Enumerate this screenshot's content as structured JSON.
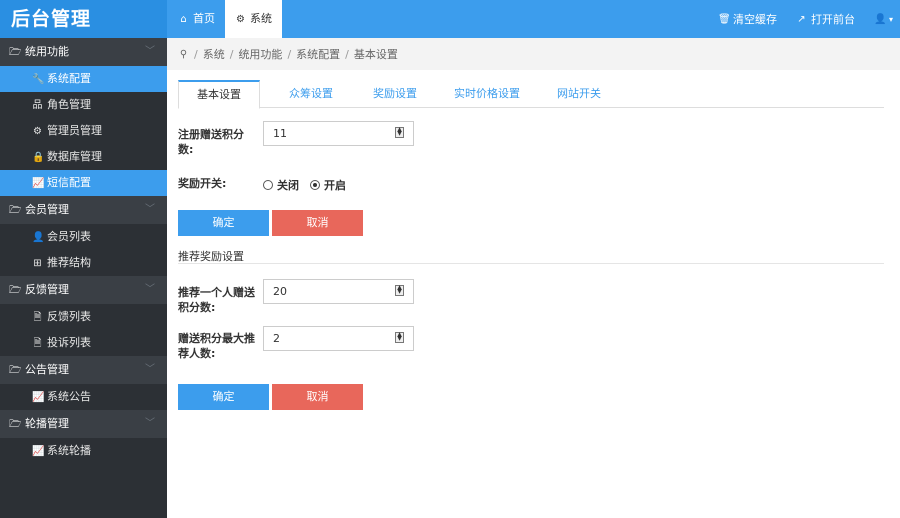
{
  "app": {
    "title": "后台管理"
  },
  "top_tabs": [
    {
      "icon": "home-icon",
      "label": "首页"
    },
    {
      "icon": "gear-icon",
      "label": "系统"
    }
  ],
  "top_actions": {
    "clear_cache": "清空缓存",
    "open_front": "打开前台"
  },
  "sidebar": {
    "groups": [
      {
        "label": "统用功能",
        "items": [
          {
            "icon": "wrench-icon",
            "label": "系统配置"
          },
          {
            "icon": "sitemap-icon",
            "label": "角色管理"
          },
          {
            "icon": "gear-icon",
            "label": "管理员管理"
          },
          {
            "icon": "lock-icon",
            "label": "数据库管理"
          },
          {
            "icon": "chart-icon",
            "label": "短信配置"
          }
        ]
      },
      {
        "label": "会员管理",
        "items": [
          {
            "icon": "user-icon",
            "label": "会员列表"
          },
          {
            "icon": "grid-icon",
            "label": "推荐结构"
          }
        ]
      },
      {
        "label": "反馈管理",
        "items": [
          {
            "icon": "doc-icon",
            "label": "反馈列表"
          },
          {
            "icon": "doc-icon",
            "label": "投诉列表"
          }
        ]
      },
      {
        "label": "公告管理",
        "items": [
          {
            "icon": "chart-icon",
            "label": "系统公告"
          }
        ]
      },
      {
        "label": "轮播管理",
        "items": [
          {
            "icon": "chart-icon",
            "label": "系统轮播"
          }
        ]
      }
    ]
  },
  "breadcrumb": [
    "系统",
    "统用功能",
    "系统配置",
    "基本设置"
  ],
  "tabs": [
    "基本设置",
    "众筹设置",
    "奖励设置",
    "实时价格设置",
    "网站开关"
  ],
  "form": {
    "register_points_label": "注册赠送积分数:",
    "register_points_value": "11",
    "reward_switch_label": "奖励开关:",
    "reward_off": "关闭",
    "reward_on": "开启",
    "confirm": "确定",
    "cancel": "取消",
    "section_title": "推荐奖励设置",
    "refer_points_label": "推荐一个人赠送积分数:",
    "refer_points_value": "20",
    "max_refer_label": "赠送积分最大推荐人数:",
    "max_refer_value": "2"
  },
  "colors": {
    "primary": "#3c9ded",
    "danger": "#e8675b",
    "sidebar_bg": "#2c3035"
  }
}
